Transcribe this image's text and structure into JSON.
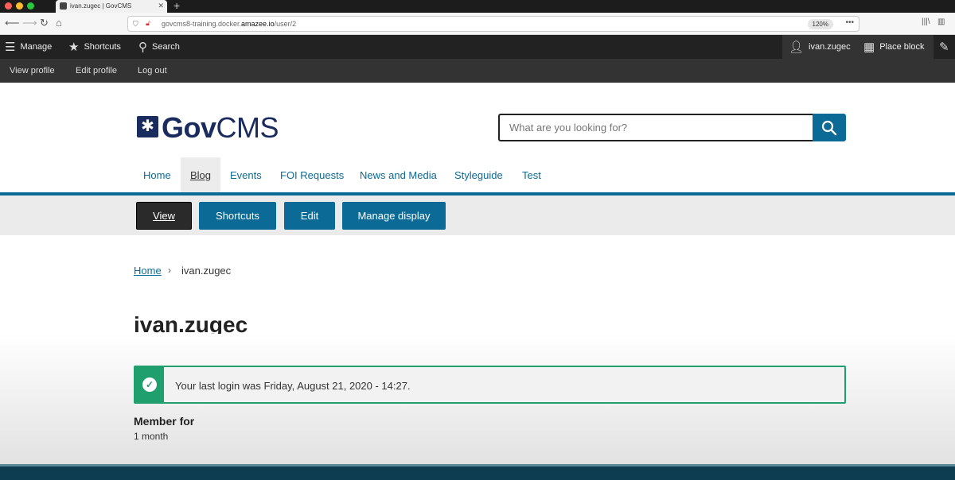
{
  "browser": {
    "tab_title": "ivan.zugec | GovCMS",
    "url_prefix": "govcms8-training.docker.",
    "url_host": "amazee.io",
    "url_path": "/user/2",
    "zoom": "120%"
  },
  "toolbar": {
    "manage": "Manage",
    "shortcuts": "Shortcuts",
    "search": "Search",
    "user": "ivan.zugec",
    "place_block": "Place block"
  },
  "tray": {
    "view_profile": "View profile",
    "edit_profile": "Edit profile",
    "log_out": "Log out"
  },
  "header": {
    "logo_bold": "Gov",
    "logo_rest": "CMS",
    "search_placeholder": "What are you looking for?"
  },
  "nav": {
    "items": [
      "Home",
      "Blog",
      "Events",
      "FOI Requests",
      "News and Media",
      "Styleguide",
      "Test"
    ]
  },
  "local_tabs": [
    "View",
    "Shortcuts",
    "Edit",
    "Manage display"
  ],
  "breadcrumb": {
    "home": "Home",
    "separator": "›",
    "current": "ivan.zugec"
  },
  "page": {
    "title": "ivan.zugec",
    "status_message": "Your last login was Friday, August 21, 2020 - 14:27.",
    "member_for_label": "Member for",
    "member_for_value": "1 month"
  },
  "colors": {
    "accent": "#0b6a96",
    "logo": "#1a2b5e",
    "success": "#1f9e6e",
    "toolbar": "#222222"
  }
}
